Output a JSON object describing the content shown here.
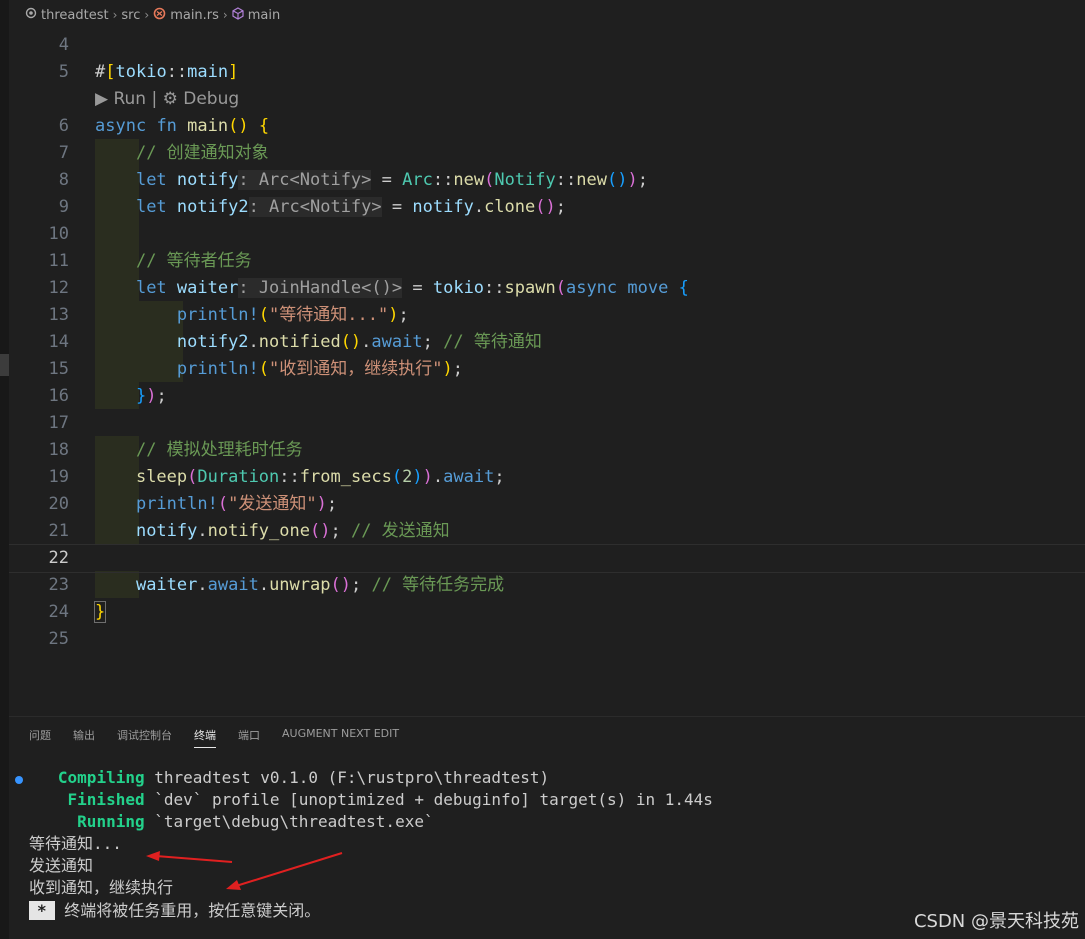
{
  "breadcrumb": {
    "items": [
      "threadtest",
      "src",
      "main.rs",
      "main"
    ]
  },
  "editor": {
    "codelens": "▶ Run | ⚙ Debug",
    "line_numbers": [
      "4",
      "5",
      "6",
      "7",
      "8",
      "9",
      "10",
      "11",
      "12",
      "13",
      "14",
      "15",
      "16",
      "17",
      "18",
      "19",
      "20",
      "21",
      "22",
      "23",
      "24",
      "25"
    ],
    "active_line": "22"
  },
  "panel": {
    "tabs": [
      "问题",
      "输出",
      "调试控制台",
      "终端",
      "端口",
      "AUGMENT NEXT EDIT"
    ],
    "active_tab": "终端"
  },
  "terminal": {
    "compiling_label": "Compiling",
    "compiling_text": " threadtest v0.1.0 (F:\\rustpro\\threadtest)",
    "finished_label": "Finished",
    "finished_text": " `dev` profile [unoptimized + debuginfo] target(s) in 1.44s",
    "running_label": "Running",
    "running_text": " `target\\debug\\threadtest.exe`",
    "out1": "等待通知...",
    "out2": "发送通知",
    "out3": "收到通知，继续执行",
    "star": "*",
    "close_msg": " 终端将被任务重用，按任意键关闭。"
  },
  "watermark": "CSDN @景天科技苑",
  "colors": {
    "background": "#1f1f1f",
    "keyword": "#569cd6",
    "comment": "#6a9955",
    "string": "#ce9178",
    "type": "#4ec9b0",
    "arrow": "#e02020"
  }
}
